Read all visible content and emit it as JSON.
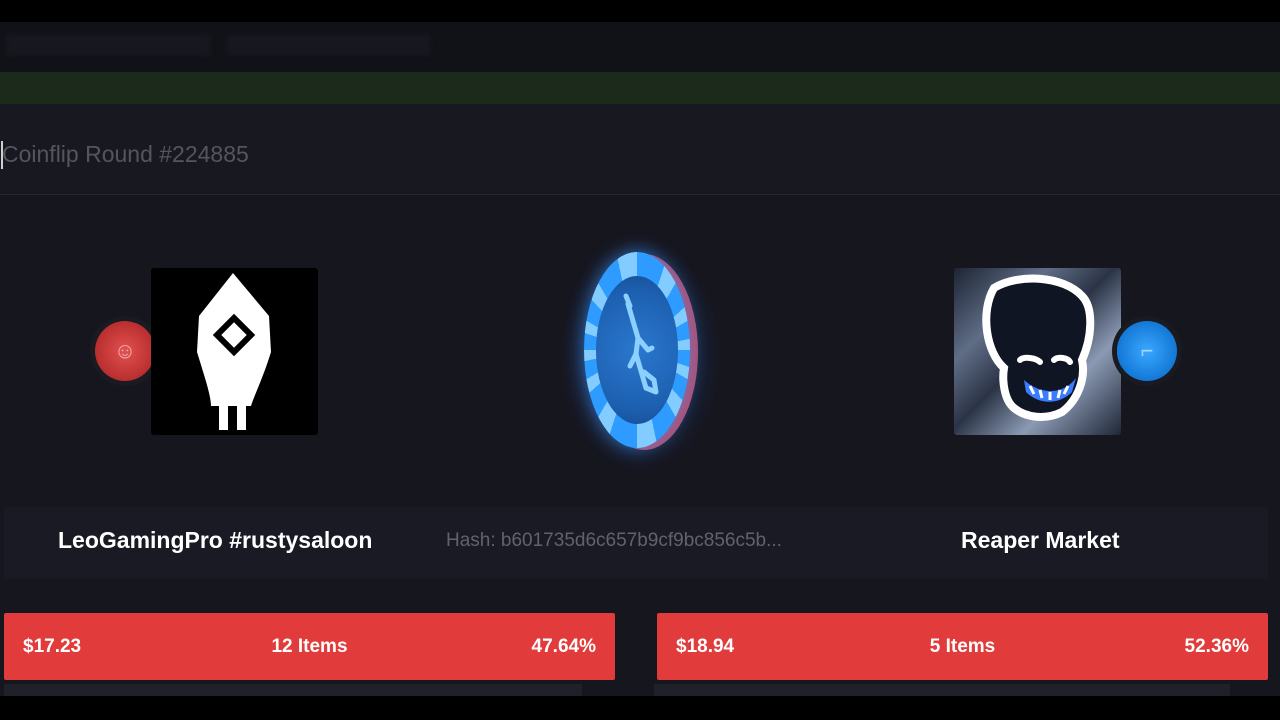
{
  "round": {
    "title": "Coinflip Round #224885"
  },
  "hash": "Hash: b601735d6c657b9cf9bc856c5b...",
  "players": {
    "left": {
      "name": "LeoGamingPro #rustysaloon",
      "amount": "$17.23",
      "items": "12 Items",
      "percent": "47.64%",
      "side": "red"
    },
    "right": {
      "name": "Reaper Market",
      "amount": "$18.94",
      "items": "5 Items",
      "percent": "52.36%",
      "side": "blue"
    }
  },
  "icons": {
    "coin": "rifle-coin-icon",
    "left_badge": "red-coin-side-icon",
    "right_badge": "blue-coin-side-icon"
  },
  "colors": {
    "background": "#16161f",
    "stats_bar": "#e23b3b",
    "red_side": "#d33a3a",
    "blue_side": "#2392f0",
    "coin_blue": "#2d9bff"
  }
}
